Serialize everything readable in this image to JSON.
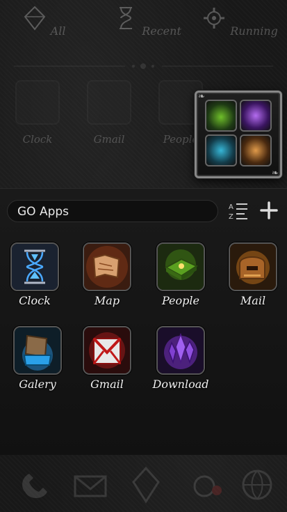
{
  "top_tabs": [
    {
      "label": "All",
      "icon": "diamond-icon"
    },
    {
      "label": "Recent",
      "icon": "hourglass-icon"
    },
    {
      "label": "Running",
      "icon": "gear-icon"
    }
  ],
  "background_apps": [
    {
      "label": "Clock",
      "icon": "hourglass-icon"
    },
    {
      "label": "Gmail",
      "icon": "envelope-icon"
    },
    {
      "label": "People",
      "icon": "book-icon"
    }
  ],
  "folder_preview": {
    "icons": [
      "map-icon",
      "phone-icon",
      "gallery-icon",
      "map-icon"
    ]
  },
  "folder": {
    "name": "GO Apps",
    "sort_icon": "sort-az-icon",
    "add_icon": "plus-icon"
  },
  "apps": [
    {
      "label": "Clock",
      "icon": "hourglass-icon"
    },
    {
      "label": "Map",
      "icon": "scroll-map-icon"
    },
    {
      "label": "People",
      "icon": "book-icon"
    },
    {
      "label": "Mail",
      "icon": "mailbox-icon"
    },
    {
      "label": "Galery",
      "icon": "gallery-icon"
    },
    {
      "label": "Gmail",
      "icon": "envelope-icon"
    },
    {
      "label": "Download",
      "icon": "crystal-icon"
    }
  ],
  "dock": [
    "phone-icon",
    "envelope-icon",
    "diamond-icon",
    "camera-icon",
    "globe-icon"
  ]
}
